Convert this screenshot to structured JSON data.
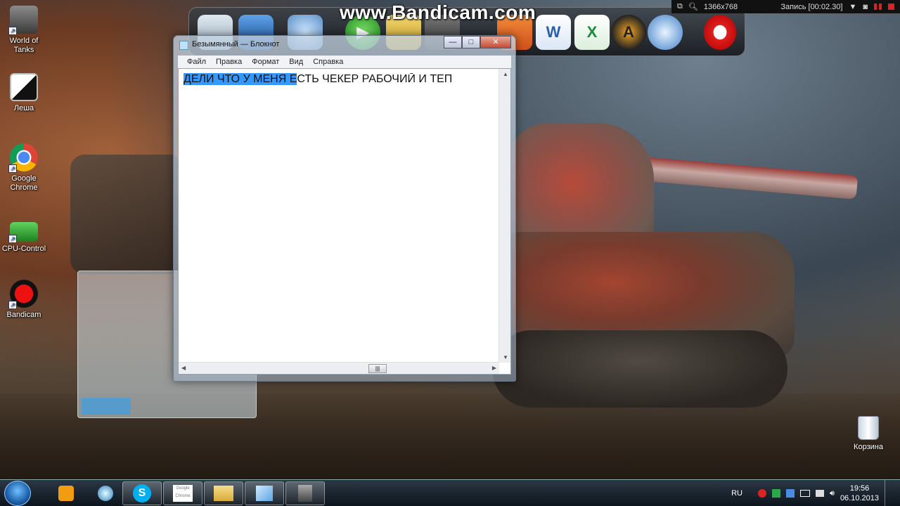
{
  "recording": {
    "watermark": "www.Bandicam.com",
    "resolution": "1366x768",
    "status": "Запись [00:02.30]"
  },
  "desktop_icons": [
    {
      "label_line1": "World of",
      "label_line2": "Tanks",
      "icon": "world-of-tanks-icon"
    },
    {
      "label_line1": "Леша",
      "label_line2": "",
      "icon": "computer-icon"
    },
    {
      "label_line1": "Google",
      "label_line2": "Chrome",
      "icon": "chrome-icon"
    },
    {
      "label_line1": "CPU-Control",
      "label_line2": "",
      "icon": "cpu-control-icon"
    },
    {
      "label_line1": "Bandicam",
      "label_line2": "",
      "icon": "bandicam-icon"
    }
  ],
  "recycle_bin": {
    "label": "Корзина"
  },
  "notepad": {
    "title": "Безымянный — Блокнот",
    "menu": [
      "Файл",
      "Правка",
      "Формат",
      "Вид",
      "Справка"
    ],
    "selected_text": "ДЕЛИ ЧТО У МЕНЯ Е",
    "rest_text": "СТЬ ЧЕКЕР РАБОЧИЙ И ТЕП",
    "minimize": "—",
    "maximize": "□",
    "close": "✕"
  },
  "dock": [
    "recycle-bin-icon",
    "computer-icon",
    "network-icon",
    "media-player-icon",
    "folder-icon",
    "files-icon",
    "word-icon",
    "excel-icon",
    "avast-icon",
    "globe-icon",
    "opera-icon"
  ],
  "taskbar": {
    "items": [
      "media-player",
      "skype",
      "google-chrome",
      "explorer",
      "notepad",
      "world-of-tanks"
    ],
    "language": "RU",
    "time": "19:56",
    "date": "06.10.2013",
    "chrome_label": "Google Chrome"
  }
}
